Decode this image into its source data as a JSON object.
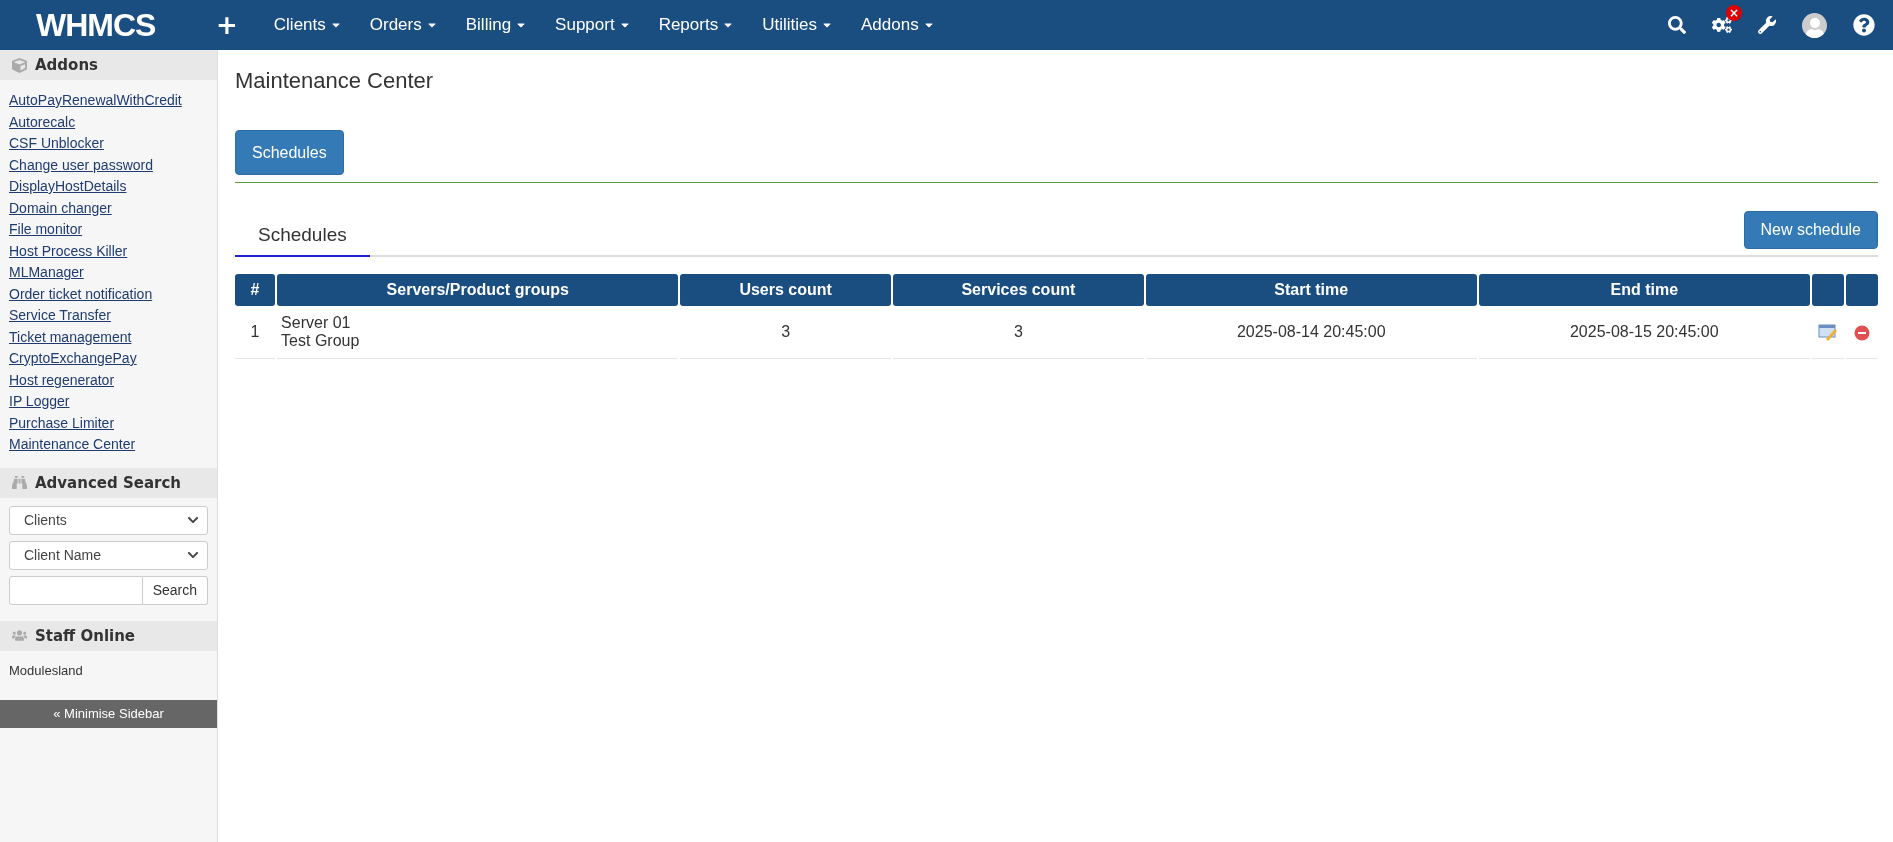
{
  "navbar": {
    "logo": "WHMCS",
    "plus": "+",
    "menus": [
      {
        "label": "Clients"
      },
      {
        "label": "Orders"
      },
      {
        "label": "Billing"
      },
      {
        "label": "Support"
      },
      {
        "label": "Reports"
      },
      {
        "label": "Utilities"
      },
      {
        "label": "Addons"
      }
    ],
    "alert_badge": "×"
  },
  "sidebar": {
    "addons": {
      "title": "Addons",
      "items": [
        "AutoPayRenewalWithCredit",
        "Autorecalc",
        "CSF Unblocker",
        "Change user password",
        "DisplayHostDetails",
        "Domain changer",
        "File monitor",
        "Host Process Killer",
        "MLManager",
        "Order ticket notification",
        "Service Transfer",
        "Ticket management",
        "CryptoExchangePay",
        "Host regenerator",
        "IP Logger",
        "Purchase Limiter",
        "Maintenance Center"
      ]
    },
    "advanced_search": {
      "title": "Advanced Search",
      "selects": [
        "Clients",
        "Client Name"
      ],
      "button": "Search"
    },
    "staff_online": {
      "title": "Staff Online",
      "names": [
        "Modulesland"
      ]
    },
    "minimise": "« Minimise Sidebar"
  },
  "page": {
    "title": "Maintenance Center",
    "top_button": "Schedules",
    "tabs": [
      {
        "label": "Schedules",
        "selected": true
      }
    ],
    "new_button": "New schedule",
    "table": {
      "columns": [
        "#",
        "Servers/Product groups",
        "Users count",
        "Services count",
        "Start time",
        "End time"
      ],
      "rows": [
        {
          "index": "1",
          "groups": [
            "Server 01",
            "Test Group"
          ],
          "users": "3",
          "services": "3",
          "start": "2025-08-14 20:45:00",
          "end": "2025-08-15 20:45:00"
        }
      ]
    }
  }
}
